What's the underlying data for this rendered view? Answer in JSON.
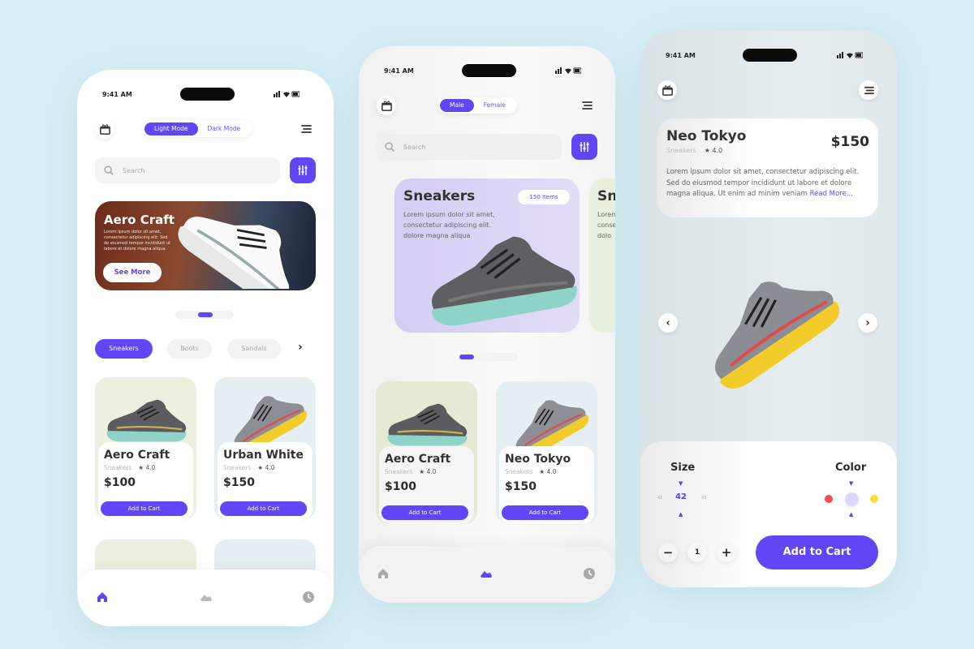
{
  "colors": {
    "accent": "#6246f5",
    "background": "#d7eef5",
    "size_color": "#5a3ff0"
  },
  "status_bar": {
    "time": "9:41 AM"
  },
  "home": {
    "mode_toggle": [
      "Light Mode",
      "Dark Mode"
    ],
    "search_placeholder": "Search",
    "banner": {
      "title": "Aero Craft",
      "text": "Lorem ipsum dolor sit amet, consectetur adipiscing elit. Sed do eiusmod tempor incididunt ut labore et dolore magna aliqua.",
      "button": "See More"
    },
    "categories": [
      "Sneakers",
      "Boots",
      "Sandals"
    ],
    "products": [
      {
        "name": "Aero Craft",
        "category": "Sneakers",
        "rating": "★ 4.0",
        "price": "$100",
        "button": "Add to Cart"
      },
      {
        "name": "Urban White",
        "category": "Sneakers",
        "rating": "★ 4.0",
        "price": "$150",
        "button": "Add to Cart"
      }
    ],
    "nav": [
      "home-icon",
      "shoe-icon",
      "clock-icon"
    ]
  },
  "browse": {
    "gender_toggle": [
      "Male",
      "Female"
    ],
    "search_placeholder": "Search",
    "feature": {
      "title": "Sneakers",
      "badge": "150 Items",
      "text": "Lorem ipsum dolor sit amet, consectetur adipiscing elit. dolore magna aliqua",
      "peek_title": "Sn",
      "peek_text": "Lorem\nconse\ndolo"
    },
    "products": [
      {
        "name": "Aero Craft",
        "category": "Sneakers",
        "rating": "★ 4.0",
        "price": "$100",
        "button": "Add to Cart"
      },
      {
        "name": "Neo Tokyo",
        "category": "Sneakers",
        "rating": "★ 4.0",
        "price": "$150",
        "button": "Add to Cart"
      }
    ]
  },
  "detail": {
    "name": "Neo Tokyo",
    "category": "Sneakers",
    "rating": "★ 4.0",
    "price": "$150",
    "description": "Lorem ipsum dolor sit amet, consectetur adipiscing elit. Sed do eiusmod tempor incididunt ut labore et dolore magna aliqua. Ut enim ad minim veniam",
    "read_more": "Read More...",
    "size_label": "Size",
    "sizes": [
      "41",
      "42",
      "43"
    ],
    "selected_size": "42",
    "color_label": "Color",
    "swatches": [
      "#f25050",
      "#ddd8fb",
      "#f7e03a"
    ],
    "quantity": "1",
    "add_to_cart": "Add to Cart"
  }
}
